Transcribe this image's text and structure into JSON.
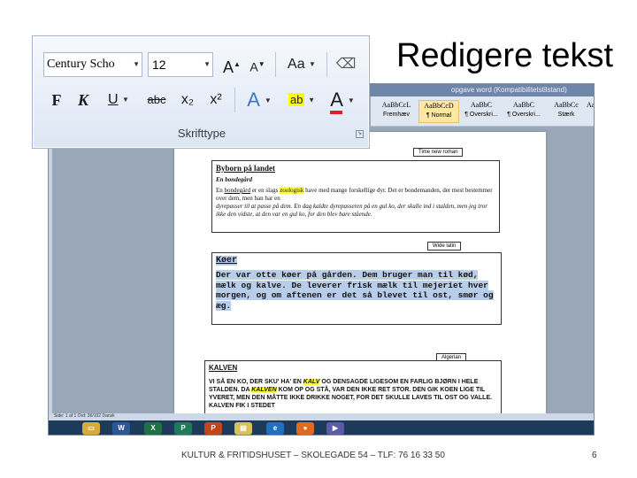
{
  "slide": {
    "title": "Redigere tekst",
    "footer": "KULTUR & FRITIDSHUSET – SKOLEGADE 54 – TLF: 76 16 33 50",
    "page_number": "6"
  },
  "ribbon": {
    "font_name": "Century Scho",
    "font_size": "12",
    "grow_font": "A",
    "shrink_font": "A",
    "change_case": "Aa",
    "bold": "F",
    "italic": "K",
    "underline": "U",
    "strikethrough": "abc",
    "subscript": "x₂",
    "superscript": "x²",
    "text_effects": "A",
    "highlight": "ab",
    "font_color": "A",
    "group_label": "Skrifttype",
    "colors": {
      "highlight": "#ffff00",
      "font_color": "#e02020",
      "text_effects": "#3a78c8"
    }
  },
  "word": {
    "title": "opgave word (Kompatibilitetstilstand)",
    "styles": [
      {
        "sample": "AaBbCcL",
        "name": "Fremhæv"
      },
      {
        "sample": "AaBbCcD",
        "name": "¶ Normal"
      },
      {
        "sample": "AaBbC",
        "name": "¶ Overskri..."
      },
      {
        "sample": "AaBbC",
        "name": "¶ Overskri..."
      },
      {
        "sample": "AaBbCc",
        "name": "Stærk"
      },
      {
        "sample": "AaBbCc",
        "name": ""
      }
    ],
    "status": "Side: 1 af 1    Ord: 36/102    Dansk"
  },
  "doc": {
    "box1": {
      "label": "Time new roman",
      "heading": "Byborn på landet",
      "subheading": "En bondegård",
      "p1_pre": "En ",
      "p1_link": "bondegård",
      "p1_mid": " er en slags ",
      "p1_hl": "zoologisk",
      "p1_post": " have med mange forskellige dyr. Det er bondemanden, der mest bestemmer over dem, men han har en",
      "p2": "dyrepasser til at passe på dem. En dag kaldte dyrepasseren på en gul ko, der skulle ind i stalden, men jeg tror ikke den vidste, at den var en gul ko, for den blev bare stående."
    },
    "box2": {
      "label": "Wide latin",
      "heading": "Køer",
      "paragraph": "Der var otte køer på gården. Dem bruger man til kød, mælk og kalve. De leverer frisk mælk til mejeriet hver morgen, og om aftenen er det så blevet til ost, smør og æg."
    },
    "box3": {
      "label": "Algerian",
      "heading": "KALVEN",
      "p_pre": "VI SÅ EN KO, DER SKU' HA' EN ",
      "p_hl1": "KALV",
      "p_mid": " OG DENSAGDE LIGESOM EN FARLIG BJØRN I HELE STALDEN. DA ",
      "p_hl2": "KALVEN",
      "p_post": " KOM OP OG STÅ, VAR DEN IKKE RET STOR. DEN GIK KOEN LIGE TIL YVERET, MEN DEN MÅTTE IKKE DRIKKE NOGET, FOR DET SKULLE LAVES TIL OST OG VALLE. KALVEN FIK I STEDET"
    }
  },
  "taskbar": {
    "icons": [
      "folder-icon",
      "word-icon",
      "excel-icon",
      "publisher-icon",
      "powerpoint-icon",
      "explorer-icon",
      "ie-icon",
      "firefox-icon",
      "media-icon"
    ]
  }
}
